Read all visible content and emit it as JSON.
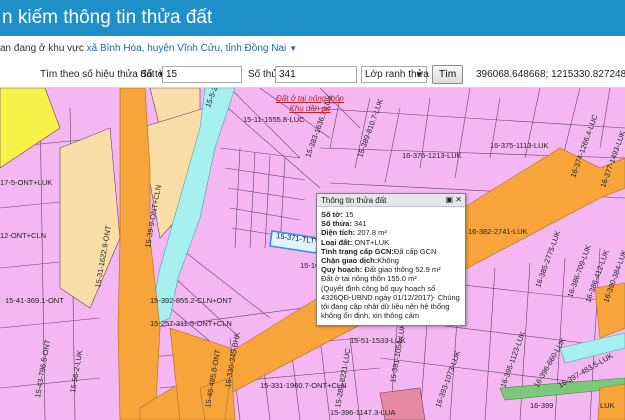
{
  "header": {
    "title": "n kiếm thông tin thửa đất"
  },
  "location": {
    "prefix": "an đang ở khu vực",
    "place": "xã Bình Hòa, huyện Vĩnh Cửu, tỉnh Đồng Nai"
  },
  "search": {
    "mode_label": "Tìm theo số hiệu thửa đất",
    "sheet_label": "Số tờ:",
    "sheet_value": "15",
    "parcel_label": "Số thửa:",
    "parcel_value": "341",
    "layer_select": "Lớp ranh thửa",
    "search_button": "Tìm",
    "coordinates": "396068.648668; 1215330.827248"
  },
  "map": {
    "red_label_line1": "Đất ở tại nông thôn",
    "red_label_line2": "Khu dân cư",
    "parcel_labels": [
      "15-11-1555.8-LUC",
      "15-383-1636.7-LUK",
      "15-389-810.7-LUK",
      "16-376-1213-LUK",
      "16-375-1113-LUK",
      "16-374-1266.4-LUC",
      "16-377-1493-LUK",
      "16-382-2741-LUK",
      "16-385-2775-LUK",
      "16-386-709-LUK",
      "16-386-412-LUK",
      "16-390-384-LUK",
      "15-31-1622.9-ONT",
      "15-39-9-ONT+CLN",
      "17-5-ONT+LUK",
      "12-ONT+CLN",
      "15-41-369.1-ONT",
      "15-392-855.2-CLN+ONT",
      "15-257-311.5-ONT+CLN",
      "15-330-345-BHK",
      "15-331-1960.7-ONT+CLN",
      "15-396-1147.3-LUA",
      "16-393-1073-LUK",
      "16-395-1123-LUK",
      "16-396-660-LUK",
      "16-397-483.5-LUK",
      "15-391-1054-LUK",
      "15-289-8221-LUC",
      "15-5-276.5-ONT",
      "15-16-22-ONT",
      "15-43-796.5-ONT",
      "15-46-485.8-ONT",
      "15-56-2-LUK",
      "15-371-TLTV",
      "15-51-1533-LUK",
      "16-399",
      "LUK"
    ]
  },
  "popup": {
    "title": "Thông tin thửa đất",
    "sheet_label": "Số tờ:",
    "sheet_value": "15",
    "parcel_label": "Số thửa:",
    "parcel_value": "341",
    "area_label": "Diện tích:",
    "area_value": "207.8 m²",
    "landtype_label": "Loại đất:",
    "landtype_value": "ONT+LUK",
    "cert_label": "Tình trạng cấp GCN:",
    "cert_value": "Đã cấp GCN",
    "block_label": "Chặn giao dịch:",
    "block_value": "Không",
    "plan_label": "Quy hoạch:",
    "plan_value": "Đất giao thông 52.9 m²",
    "plan_line2": "Đất ở tại nông thôn 155.0 m²",
    "note": "(Quyết định công bố quy hoạch số 4326QĐ-UBND ngày 01/12/2017)- Chúng tôi đang cập nhật dữ liệu nên hệ thống không ổn định, xin thông cảm"
  },
  "colors": {
    "header": "#1f8fc9",
    "parcel": "#f4b7f2",
    "road": "#f7a53a",
    "river": "#a6f0f0",
    "residential": "#f9dfa7",
    "yellow": "#f7f24a"
  }
}
